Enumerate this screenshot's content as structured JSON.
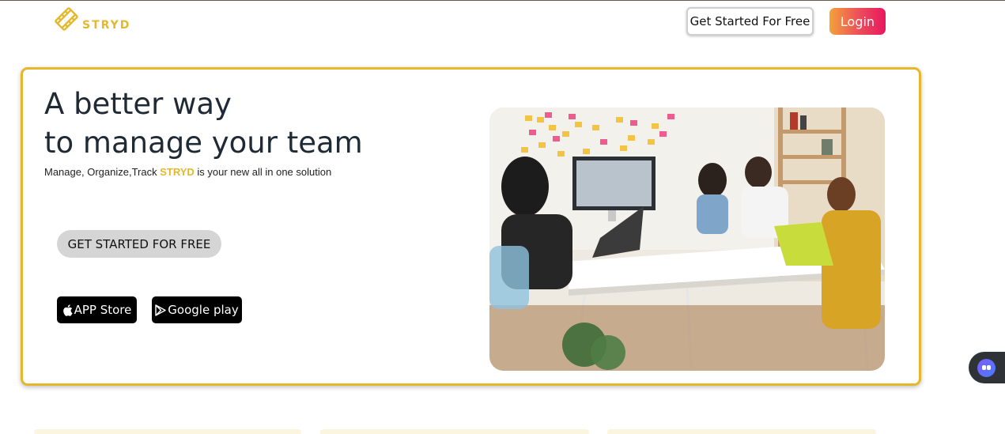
{
  "header": {
    "logo_text": "STRYD",
    "get_started_label": "Get Started For Free",
    "login_label": "Login",
    "login_gradient": [
      "#f2a33a",
      "#e8185f"
    ]
  },
  "hero": {
    "title_line1": "A better way",
    "title_line2": "to manage your team",
    "tagline_prefix": "Manage, Organize,Track ",
    "tagline_brand": "STRYD",
    "tagline_suffix": " is your new all in one solution",
    "cta_label": "GET STARTED FOR FREE",
    "app_store_label": "APP Store",
    "google_play_label": "Google play",
    "image_icon": "team-meeting-photo"
  },
  "widget": {
    "icon": "chat-bot-icon"
  },
  "colors": {
    "accent": "#e7b62a",
    "brand_text": "#e4b82c",
    "heading": "#1f2a35"
  }
}
